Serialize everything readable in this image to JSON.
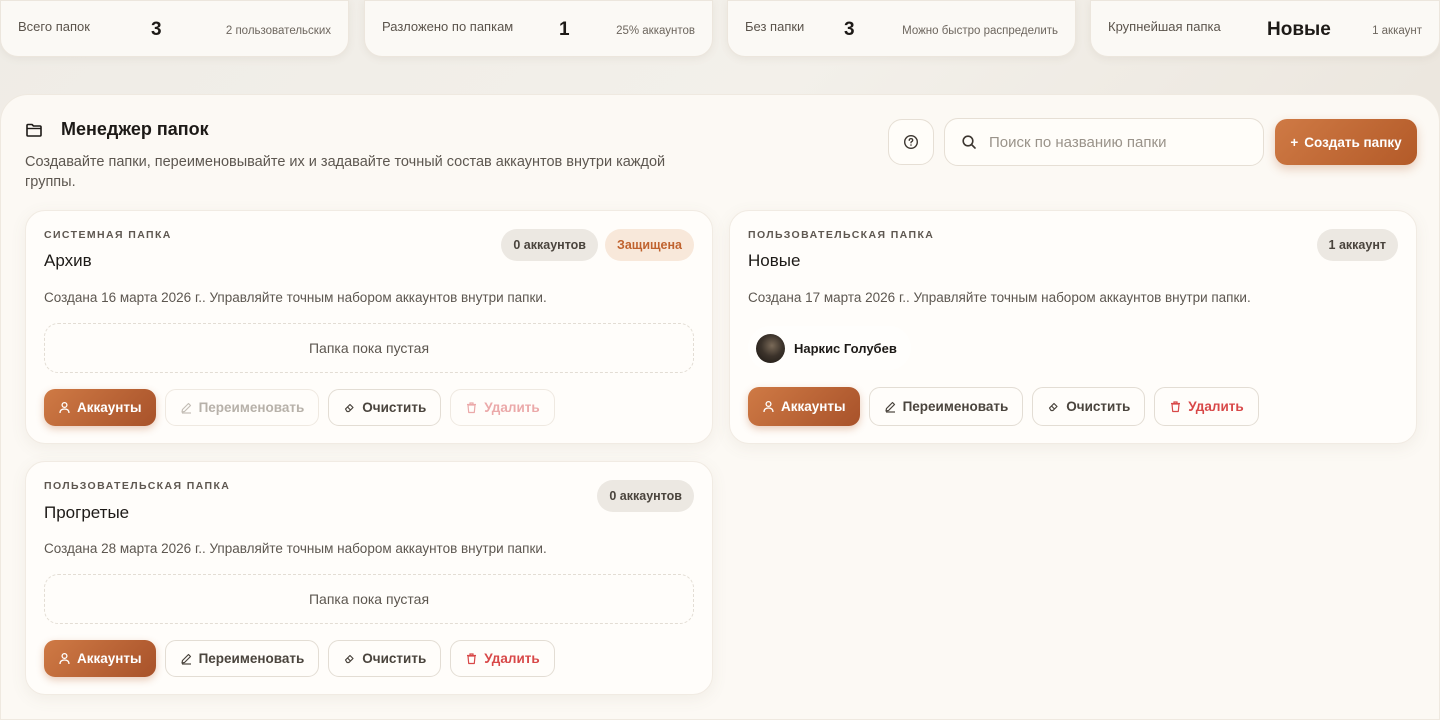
{
  "stats": [
    {
      "label": "Всего папок",
      "value": "3",
      "sub": "2 пользовательских"
    },
    {
      "label": "Разложено по папкам",
      "value": "1",
      "sub": "25% аккаунтов"
    },
    {
      "label": "Без папки",
      "value": "3",
      "sub": "Можно быстро распределить"
    },
    {
      "label": "Крупнейшая папка",
      "value": "Новые",
      "sub": "1 аккаунт"
    }
  ],
  "header": {
    "title": "Менеджер папок",
    "description": "Создавайте папки, переименовывайте их и задавайте точный состав аккаунтов внутри каждой группы.",
    "search_placeholder": "Поиск по названию папки",
    "create_label": "Создать папку"
  },
  "folders": [
    {
      "kind": "СИСТЕМНАЯ ПАПКА",
      "name": "Архив",
      "count": "0 аккаунтов",
      "protected": "Защищена",
      "desc": "Создана 16 марта 2026 г.. Управляйте точным набором аккаунтов внутри папки.",
      "empty": "Папка пока пустая",
      "actions": {
        "accounts": "Аккаунты",
        "rename": "Переименовать",
        "clear": "Очистить",
        "delete": "Удалить"
      }
    },
    {
      "kind": "ПОЛЬЗОВАТЕЛЬСКАЯ ПАПКА",
      "name": "Новые",
      "count": "1 аккаунт",
      "desc": "Создана 17 марта 2026 г.. Управляйте точным набором аккаунтов внутри папки.",
      "member": "Наркис Голубев",
      "actions": {
        "accounts": "Аккаунты",
        "rename": "Переименовать",
        "clear": "Очистить",
        "delete": "Удалить"
      }
    },
    {
      "kind": "ПОЛЬЗОВАТЕЛЬСКАЯ ПАПКА",
      "name": "Прогретые",
      "count": "0 аккаунтов",
      "desc": "Создана 28 марта 2026 г.. Управляйте точным набором аккаунтов внутри папки.",
      "empty": "Папка пока пустая",
      "actions": {
        "accounts": "Аккаунты",
        "rename": "Переименовать",
        "clear": "Очистить",
        "delete": "Удалить"
      }
    }
  ],
  "colors": {
    "accent": "#c0632f",
    "danger": "#d84848",
    "background": "#fcf9f4"
  },
  "icons": {
    "title": "folder-icon",
    "help": "question-icon",
    "search": "search-icon",
    "create": "plus-icon"
  }
}
